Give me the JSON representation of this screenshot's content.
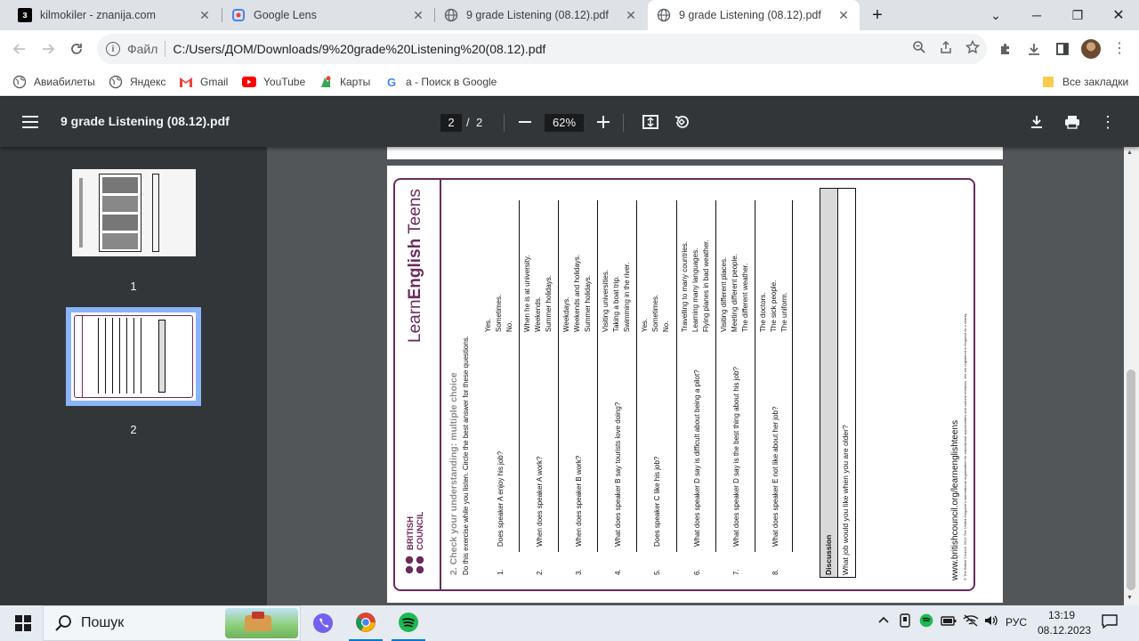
{
  "browser": {
    "tabs": [
      {
        "title": "kilmokiler - znanija.com",
        "favicon": "znanija-icon",
        "active": false
      },
      {
        "title": "Google Lens",
        "favicon": "google-lens-icon",
        "active": false
      },
      {
        "title": "9 grade Listening (08.12).pdf",
        "favicon": "globe-icon",
        "active": false
      },
      {
        "title": "9 grade Listening (08.12).pdf",
        "favicon": "globe-icon",
        "active": true
      }
    ],
    "address": {
      "scheme": "Файл",
      "url": "C:/Users/ДОМ/Downloads/9%20grade%20Listening%20(08.12).pdf"
    },
    "bookmarks": [
      {
        "label": "Авиабилеты",
        "icon": "globe-icon"
      },
      {
        "label": "Яндекс",
        "icon": "globe-icon"
      },
      {
        "label": "Gmail",
        "icon": "gmail-icon"
      },
      {
        "label": "YouTube",
        "icon": "youtube-icon"
      },
      {
        "label": "Карты",
        "icon": "maps-icon"
      },
      {
        "label": "а - Поиск в Google",
        "icon": "google-icon"
      }
    ],
    "all_bookmarks": "Все закладки"
  },
  "pdf": {
    "title": "9 grade Listening (08.12).pdf",
    "current_page": "2",
    "separator": "/",
    "total_pages": "2",
    "zoom": "62%",
    "thumbnails": [
      {
        "label": "1"
      },
      {
        "label": "2"
      }
    ]
  },
  "document": {
    "logo": "LearnEnglish Teens",
    "logo_learn": "Learn",
    "logo_english": "English",
    "logo_teens": "Teens",
    "council_line1": "BRITISH",
    "council_line2": "COUNCIL",
    "section_title": "2. Check your understanding: multiple choice",
    "instructions": "Do this exercise while you listen. Circle the best answer for these questions.",
    "questions": [
      {
        "num": "1.",
        "text": "Does speaker A enjoy his job?",
        "options": [
          "Yes.",
          "Sometimes.",
          "No."
        ]
      },
      {
        "num": "2.",
        "text": "When does speaker A work?",
        "options": [
          "When he is at university.",
          "Weekends.",
          "Summer holidays."
        ]
      },
      {
        "num": "3.",
        "text": "When does speaker B work?",
        "options": [
          "Weekdays.",
          "Weekends and holidays.",
          "Summer holidays."
        ]
      },
      {
        "num": "4.",
        "text": "What does speaker B say tourists love doing?",
        "options": [
          "Visiting universities.",
          "Taking a boat trip.",
          "Swimming in the river."
        ]
      },
      {
        "num": "5.",
        "text": "Does speaker C like his job?",
        "options": [
          "Yes.",
          "Sometimes.",
          "No."
        ]
      },
      {
        "num": "6.",
        "text": "What does speaker D say is difficult about being a pilot?",
        "options": [
          "Travelling to many countries.",
          "Learning many languages.",
          "Flying planes in bad weather."
        ]
      },
      {
        "num": "7.",
        "text": "What does speaker D say is the best thing about his job?",
        "options": [
          "Visiting different places.",
          "Meeting different people.",
          "The different weather."
        ]
      },
      {
        "num": "8.",
        "text": "What does speaker E not like about her job?",
        "options": [
          "The doctors.",
          "The sick people.",
          "The uniform."
        ]
      }
    ],
    "discussion_title": "Discussion",
    "discussion_question": "What job would you like when you are older?",
    "footer_url": "www.britishcouncil.org/learnenglishteens",
    "footer_small": "© The British Council, 2012 The United Kingdom's international organisation for educational opportunities and cultural relations. We are registered in England as a charity."
  },
  "taskbar": {
    "search_label": "Пошук",
    "language": "РУС",
    "time": "13:19",
    "date": "08.12.2023"
  },
  "colors": {
    "brand_purple": "#6b2a5c",
    "pdf_toolbar": "#323639",
    "viewer_bg": "#525659",
    "thumb_selected": "#8ab4f8"
  }
}
